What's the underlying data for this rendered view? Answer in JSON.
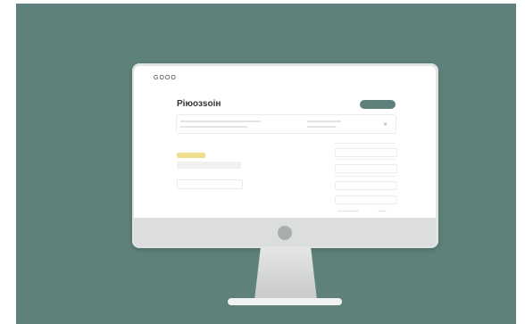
{
  "app": {
    "logo_text": "GOOO"
  },
  "header": {
    "title": "Ріюозsоін"
  },
  "colors": {
    "background": "#5f817b",
    "accent": "#5f817b",
    "badge": "#f0df8a"
  },
  "icons": {
    "card_icon": "close-icon"
  }
}
